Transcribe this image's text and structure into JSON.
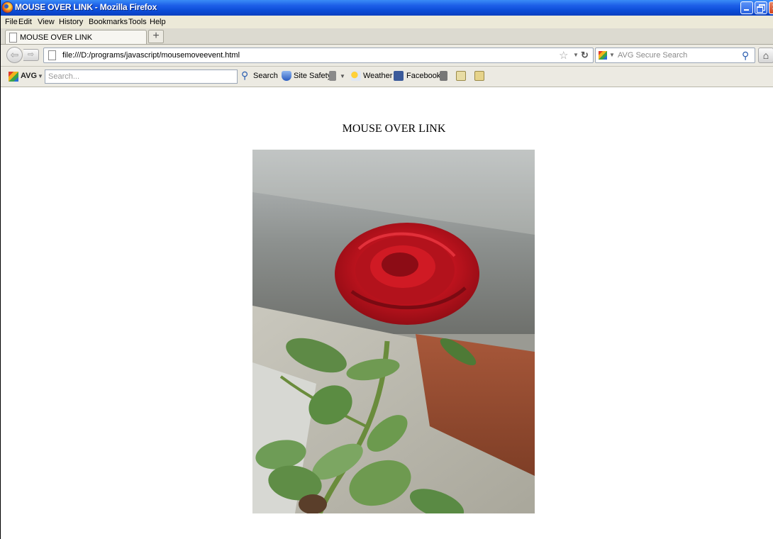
{
  "window": {
    "title": "MOUSE OVER LINK - Mozilla Firefox"
  },
  "menu": [
    "File",
    "Edit",
    "View",
    "History",
    "Bookmarks",
    "Tools",
    "Help"
  ],
  "tab": {
    "label": "MOUSE OVER LINK",
    "new_tab": "+"
  },
  "navbar": {
    "url": "file:///D:/programs/javascript/mousemoveevent.html",
    "search_placeholder": "AVG Secure Search"
  },
  "avg_toolbar": {
    "brand": "AVG",
    "search_placeholder": "Search...",
    "search_label": "Search",
    "site_safety": "Site Safety",
    "weather": "Weather",
    "facebook": "Facebook"
  },
  "page": {
    "heading": "MOUSE OVER LINK",
    "image_icon": "rose-photo"
  }
}
